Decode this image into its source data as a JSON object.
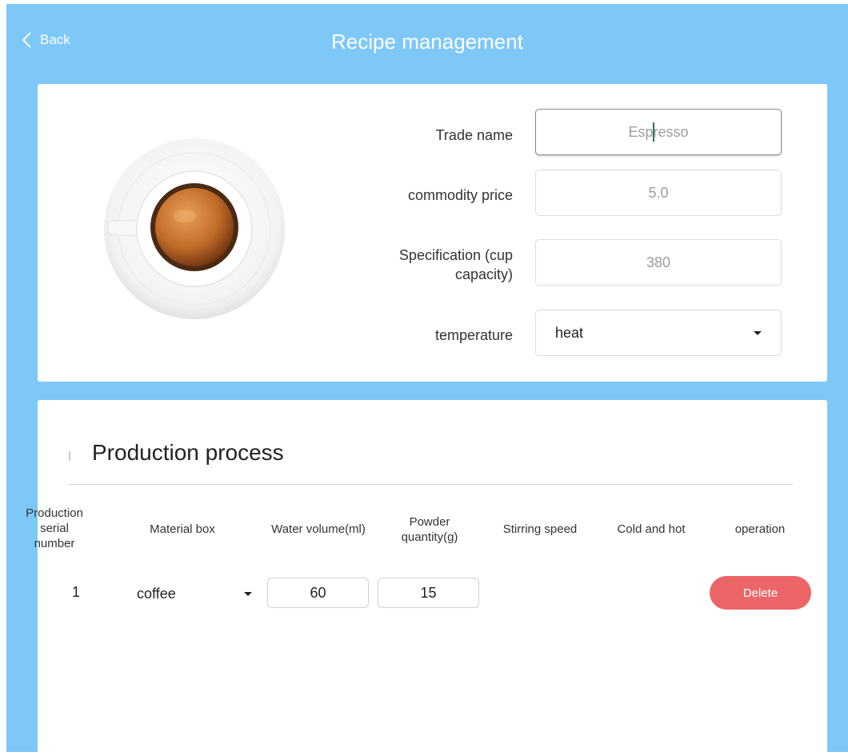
{
  "header": {
    "back_label": "Back",
    "title": "Recipe management"
  },
  "product": {
    "image_icon": "espresso-cup-icon",
    "fields": {
      "trade_name_label": "Trade name",
      "trade_name_value": "Espresso",
      "price_label": "commodity price",
      "price_value": "5.0",
      "spec_label_line1": "Specification (cup",
      "spec_label_line2": "capacity)",
      "spec_value": "380",
      "temperature_label": "temperature",
      "temperature_value": "heat"
    }
  },
  "process": {
    "section_title": "Production process",
    "columns": {
      "serial_line1": "Production",
      "serial_line2": "serial",
      "serial_line3": "number",
      "material_box": "Material box",
      "water_volume": "Water volume(ml)",
      "powder_line1": "Powder",
      "powder_line2": "quantity(g)",
      "stirring_speed": "Stirring speed",
      "cold_hot": "Cold and hot",
      "operation": "operation"
    },
    "rows": [
      {
        "serial": "1",
        "material": "coffee",
        "water": "60",
        "powder": "15",
        "delete_label": "Delete"
      }
    ]
  },
  "colors": {
    "background": "#7ec8f8",
    "delete": "#ec6668"
  }
}
